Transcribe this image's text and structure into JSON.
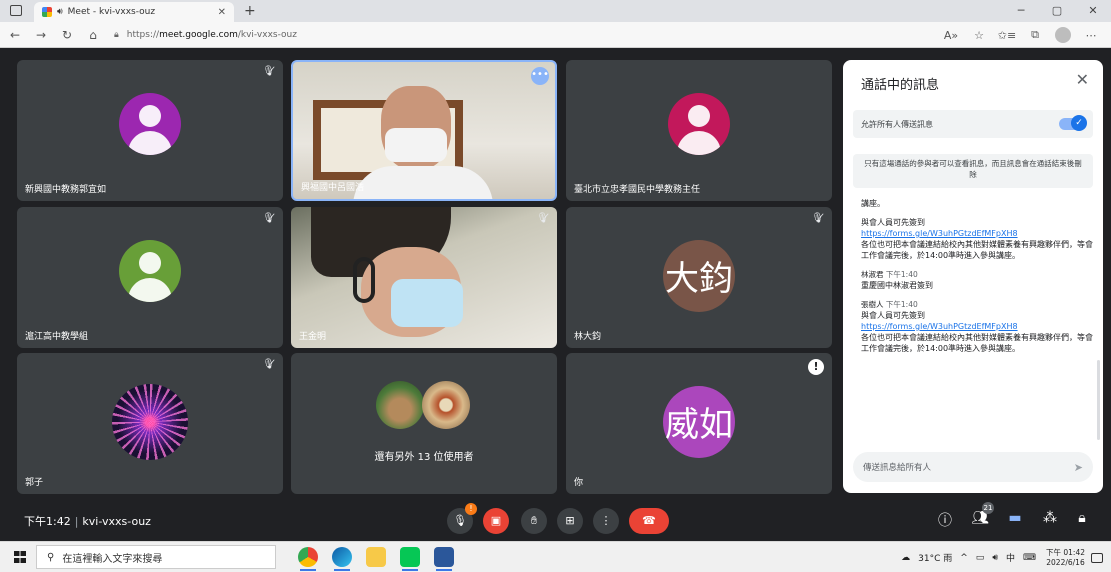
{
  "browser": {
    "tab_title": "Meet - kvi-vxxs-ouz",
    "url_scheme": "https://",
    "url_host": "meet.google.com",
    "url_path": "/kvi-vxxs-ouz",
    "new_tab": "+",
    "window_controls": [
      "─",
      "▢",
      "✕"
    ]
  },
  "tiles": [
    {
      "name": "新興國中教務郭宜如",
      "type": "person",
      "color": "#9c27b0",
      "muted": true
    },
    {
      "name": "興福國中呂國浩",
      "type": "video1",
      "muted": false
    },
    {
      "name": "臺北市立忠孝國民中學教務主任",
      "type": "person",
      "color": "#c2185b",
      "muted": false
    },
    {
      "name": "滬江高中教學組",
      "type": "person",
      "color": "#689f38",
      "muted": true
    },
    {
      "name": "王金明",
      "type": "video2",
      "muted": true
    },
    {
      "name": "林大鈞",
      "type": "letter",
      "letter": "大鈞",
      "color": "#795548",
      "muted": true
    },
    {
      "name": "郭子",
      "type": "galaxy",
      "muted": true
    },
    {
      "name": "",
      "type": "others",
      "others_text": "還有另外 13 位使用者"
    },
    {
      "name": "你",
      "type": "letter",
      "letter": "威如",
      "color": "#ab47bc",
      "warning": "!"
    }
  ],
  "chat": {
    "title": "通話中的訊息",
    "allow_label": "允許所有人傳送訊息",
    "notice": "只有這場通話的參與者可以查看訊息，而且訊息會在通話結束後刪除",
    "messages": [
      {
        "sender": "",
        "time": "",
        "lines": [
          "講座。"
        ],
        "link": ""
      },
      {
        "sender": "",
        "time": "",
        "lines": [
          "與會人員可先簽到"
        ],
        "link": "https://forms.gle/W3uhPGtzdEfMFpXH8",
        "tail": "各位也可把本會議連結給校內其他對媒體素養有興趣夥伴們，等會工作會議完後，於14:00準時進入參與講座。"
      },
      {
        "sender": "林淑君",
        "time": "下午1:40",
        "lines": [
          "重慶國中林淑君簽到"
        ],
        "link": ""
      },
      {
        "sender": "張樹人",
        "time": "下午1:40",
        "lines": [
          "與會人員可先簽到"
        ],
        "link": "https://forms.gle/W3uhPGtzdEfMFpXH8",
        "tail": "各位也可把本會議連結給校內其他對媒體素養有興趣夥伴們，等會工作會議完後，於14:00準時進入參與講座。"
      }
    ],
    "input_placeholder": "傳送訊息給所有人"
  },
  "bottombar": {
    "time": "下午1:42",
    "meeting_code": "kvi-vxxs-ouz",
    "mic_badge": "!",
    "participants_count": "21"
  },
  "taskbar": {
    "search_placeholder": "在這裡輸入文字來搜尋",
    "weather": "31°C 雨",
    "ime": "中",
    "clock_time": "下午 01:42",
    "clock_date": "2022/6/16"
  }
}
